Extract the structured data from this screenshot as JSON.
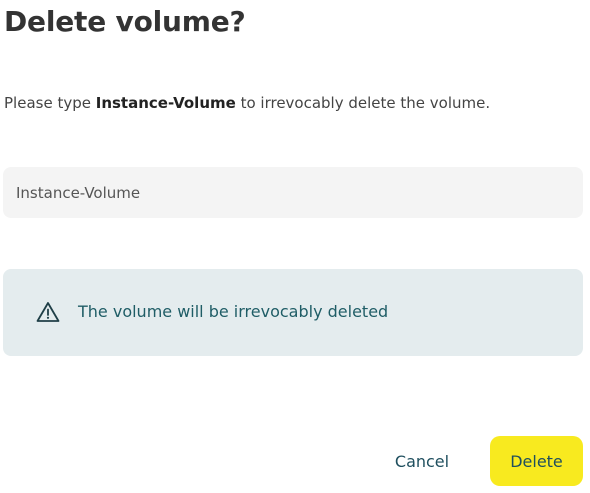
{
  "dialog": {
    "title": "Delete volume?",
    "description": {
      "prefix": "Please type ",
      "volume_name": "Instance-Volume",
      "suffix": " to irrevocably delete the volume."
    },
    "input": {
      "value": "Instance-Volume",
      "placeholder": ""
    },
    "warning": {
      "icon": "warning-triangle-icon",
      "text": "The volume will be irrevocably deleted"
    },
    "actions": {
      "cancel_label": "Cancel",
      "delete_label": "Delete"
    }
  },
  "colors": {
    "title": "#333333",
    "input_bg": "#f4f4f4",
    "warning_bg": "#e4ecee",
    "warning_text": "#1f5d66",
    "button_text": "#1f4f5e",
    "delete_bg": "#f8ea1f"
  }
}
